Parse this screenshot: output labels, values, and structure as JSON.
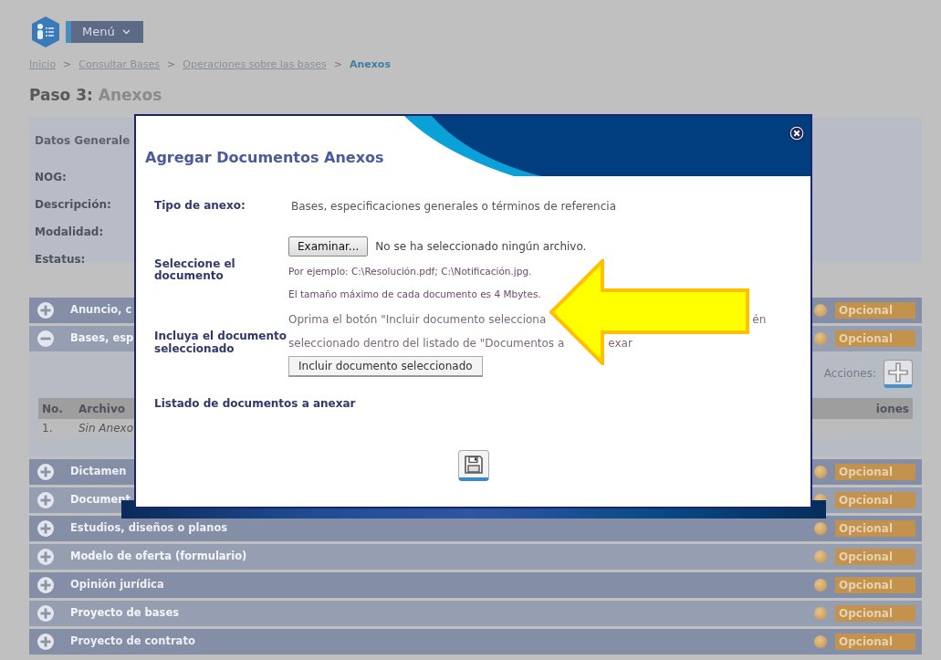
{
  "header": {
    "menu_label": "Menú"
  },
  "breadcrumb": [
    {
      "label": "Inicio",
      "current": false
    },
    {
      "prefix": ">",
      "label": "Consultar Bases",
      "current": false
    },
    {
      "prefix": ">",
      "label": "Operaciones sobre las bases",
      "current": false
    },
    {
      "prefix": ">",
      "label": "Anexos",
      "current": true
    }
  ],
  "page_title": {
    "step": "Paso 3:",
    "name": "Anexos"
  },
  "general_data": {
    "title": "Datos Generale",
    "fields": [
      "NOG:",
      "Descripción:",
      "Modalidad:",
      "Estatus:"
    ]
  },
  "sections": [
    {
      "title": "Anuncio, c",
      "expanded": false,
      "status": "Opcional"
    },
    {
      "title": "Bases, esp",
      "expanded": true,
      "status": "Opcional",
      "actions_label": "Acciones:",
      "table": {
        "columns": [
          "No.",
          "Archivo",
          "iones"
        ],
        "rows": [
          [
            "1.",
            "Sin Anexo"
          ]
        ]
      }
    },
    {
      "title": "Dictamen",
      "expanded": false,
      "status": "Opcional"
    },
    {
      "title": "Document",
      "expanded": false,
      "status": "Opcional"
    },
    {
      "title": "Estudios, diseños o planos",
      "expanded": false,
      "status": "Opcional"
    },
    {
      "title": "Modelo de oferta (formulario)",
      "expanded": false,
      "status": "Opcional"
    },
    {
      "title": "Opinión jurídica",
      "expanded": false,
      "status": "Opcional"
    },
    {
      "title": "Proyecto de bases",
      "expanded": false,
      "status": "Opcional"
    },
    {
      "title": "Proyecto de contrato",
      "expanded": false,
      "status": "Opcional"
    }
  ],
  "dialog": {
    "title": "Agregar Documentos Anexos",
    "type_label": "Tipo de anexo:",
    "type_value": "Bases, especificaciones generales o términos de referencia",
    "file_label": "Seleccione el documento",
    "browse_button": "Examinar...",
    "file_status": "No se ha seleccionado ningún archivo.",
    "hints": [
      "Por ejemplo: C:\\Resolución.pdf; C:\\Notificación.jpg.",
      "El tamaño máximo de cada documento es 4 Mbytes."
    ],
    "include_label": "Incluya el documento seleccionado",
    "instruction_lines": [
      [
        "Oprima el botón \"Incluir documento selecciona",
        "én"
      ],
      [
        "seleccionado dentro del listado de \"Documentos a",
        "exar"
      ]
    ],
    "include_button": "Incluir documento seleccionado",
    "list_title": "Listado de documentos a anexar"
  }
}
